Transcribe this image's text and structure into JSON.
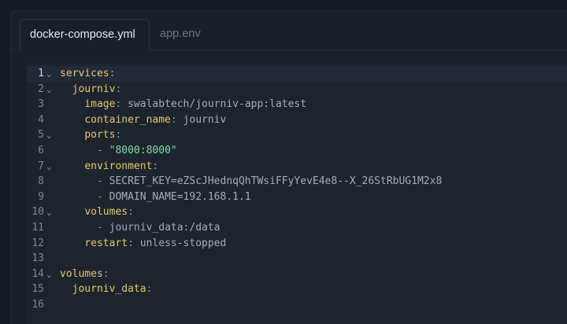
{
  "tabs": [
    {
      "label": "docker-compose.yml",
      "active": true
    },
    {
      "label": "app.env",
      "active": false
    }
  ],
  "colors": {
    "background": "#151b23",
    "editor": "#1d242e",
    "key": "#e5c76b",
    "string": "#7ee0a3",
    "value": "#a3adba"
  },
  "lines": [
    {
      "n": "1",
      "fold": true,
      "parts": [
        {
          "t": "k",
          "v": "services"
        },
        {
          "t": "p",
          "v": ":"
        }
      ]
    },
    {
      "n": "2",
      "fold": true,
      "parts": [
        {
          "t": "p",
          "v": "  "
        },
        {
          "t": "k",
          "v": "journiv"
        },
        {
          "t": "p",
          "v": ":"
        }
      ]
    },
    {
      "n": "3",
      "fold": false,
      "parts": [
        {
          "t": "p",
          "v": "    "
        },
        {
          "t": "k",
          "v": "image"
        },
        {
          "t": "p",
          "v": ": "
        },
        {
          "t": "v",
          "v": "swalabtech/journiv-app:latest"
        }
      ]
    },
    {
      "n": "4",
      "fold": false,
      "parts": [
        {
          "t": "p",
          "v": "    "
        },
        {
          "t": "k",
          "v": "container_name"
        },
        {
          "t": "p",
          "v": ": "
        },
        {
          "t": "v",
          "v": "journiv"
        }
      ]
    },
    {
      "n": "5",
      "fold": true,
      "parts": [
        {
          "t": "p",
          "v": "    "
        },
        {
          "t": "k",
          "v": "ports"
        },
        {
          "t": "p",
          "v": ":"
        }
      ]
    },
    {
      "n": "6",
      "fold": false,
      "parts": [
        {
          "t": "p",
          "v": "      - "
        },
        {
          "t": "s",
          "v": "\"8000:8000\""
        }
      ]
    },
    {
      "n": "7",
      "fold": true,
      "parts": [
        {
          "t": "p",
          "v": "    "
        },
        {
          "t": "k",
          "v": "environment"
        },
        {
          "t": "p",
          "v": ":"
        }
      ]
    },
    {
      "n": "8",
      "fold": false,
      "parts": [
        {
          "t": "p",
          "v": "      - "
        },
        {
          "t": "v",
          "v": "SECRET_KEY=eZScJHednqQhTWsiFFyYevE4e8--X_26StRbUG1M2x8"
        }
      ]
    },
    {
      "n": "9",
      "fold": false,
      "parts": [
        {
          "t": "p",
          "v": "      - "
        },
        {
          "t": "v",
          "v": "DOMAIN_NAME=192.168.1.1"
        }
      ]
    },
    {
      "n": "10",
      "fold": true,
      "parts": [
        {
          "t": "p",
          "v": "    "
        },
        {
          "t": "k",
          "v": "volumes"
        },
        {
          "t": "p",
          "v": ":"
        }
      ]
    },
    {
      "n": "11",
      "fold": false,
      "parts": [
        {
          "t": "p",
          "v": "      - "
        },
        {
          "t": "v",
          "v": "journiv_data:/data"
        }
      ]
    },
    {
      "n": "12",
      "fold": false,
      "parts": [
        {
          "t": "p",
          "v": "    "
        },
        {
          "t": "k",
          "v": "restart"
        },
        {
          "t": "p",
          "v": ": "
        },
        {
          "t": "v",
          "v": "unless-stopped"
        }
      ]
    },
    {
      "n": "13",
      "fold": false,
      "parts": []
    },
    {
      "n": "14",
      "fold": true,
      "parts": [
        {
          "t": "k",
          "v": "volumes"
        },
        {
          "t": "p",
          "v": ":"
        }
      ]
    },
    {
      "n": "15",
      "fold": false,
      "parts": [
        {
          "t": "p",
          "v": "  "
        },
        {
          "t": "k",
          "v": "journiv_data"
        },
        {
          "t": "p",
          "v": ":"
        }
      ]
    },
    {
      "n": "16",
      "fold": false,
      "parts": []
    }
  ],
  "fold_glyph": "⌄"
}
